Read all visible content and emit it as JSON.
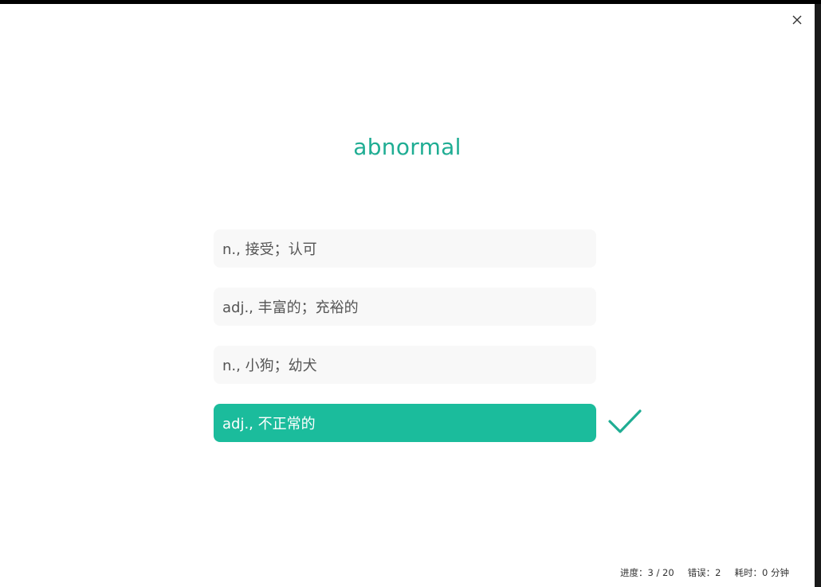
{
  "quiz": {
    "word": "abnormal",
    "options": [
      {
        "label": "n., 接受；认可",
        "correct": false
      },
      {
        "label": "adj., 丰富的；充裕的",
        "correct": false
      },
      {
        "label": "n., 小狗；幼犬",
        "correct": false
      },
      {
        "label": "adj., 不正常的",
        "correct": true
      }
    ]
  },
  "status": {
    "progress": "进度：3 / 20",
    "errors": "错误：2",
    "time": "耗时：0 分钟"
  },
  "icons": {
    "close": "close-icon",
    "check": "checkmark-icon"
  },
  "colors": {
    "accent": "#1bbc9c",
    "word": "#1fad93"
  }
}
